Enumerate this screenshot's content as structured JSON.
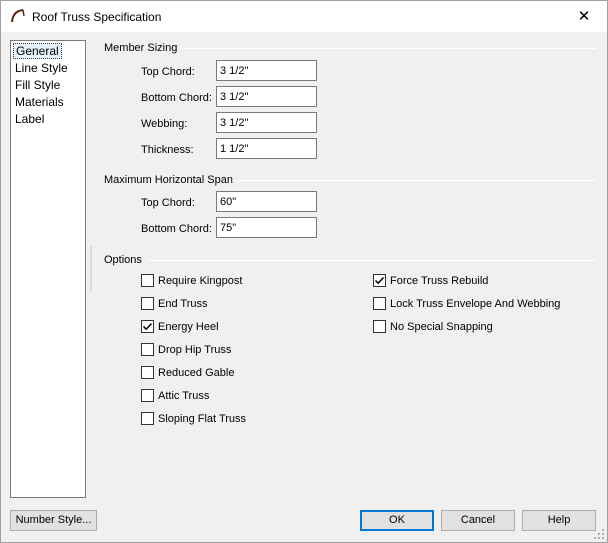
{
  "window": {
    "title": "Roof Truss Specification",
    "close_glyph": "✕"
  },
  "nav": {
    "items": [
      "General",
      "Line Style",
      "Fill Style",
      "Materials",
      "Label"
    ],
    "selected": 0
  },
  "member_sizing": {
    "title": "Member Sizing",
    "fields": [
      {
        "label": "Top Chord:",
        "value": "3 1/2\""
      },
      {
        "label": "Bottom Chord:",
        "value": "3 1/2\""
      },
      {
        "label": "Webbing:",
        "value": "3 1/2\""
      },
      {
        "label": "Thickness:",
        "value": "1 1/2\""
      }
    ]
  },
  "max_span": {
    "title": "Maximum Horizontal Span",
    "fields": [
      {
        "label": "Top Chord:",
        "value": "60\""
      },
      {
        "label": "Bottom Chord:",
        "value": "75\""
      }
    ]
  },
  "options": {
    "title": "Options",
    "left": [
      {
        "label": "Require Kingpost",
        "checked": false
      },
      {
        "label": "End Truss",
        "checked": false
      },
      {
        "label": "Energy Heel",
        "checked": true
      },
      {
        "label": "Drop Hip Truss",
        "checked": false
      },
      {
        "label": "Reduced Gable",
        "checked": false
      },
      {
        "label": "Attic Truss",
        "checked": false
      },
      {
        "label": "Sloping Flat Truss",
        "checked": false
      }
    ],
    "right": [
      {
        "label": "Force Truss Rebuild",
        "checked": true
      },
      {
        "label": "Lock Truss Envelope And Webbing",
        "checked": false
      },
      {
        "label": "No Special Snapping",
        "checked": false
      }
    ]
  },
  "buttons": {
    "number_style": "Number Style...",
    "ok": "OK",
    "cancel": "Cancel",
    "help": "Help"
  },
  "colors": {
    "focus_border": "#0078d7",
    "window_bg": "#f0f0f0"
  },
  "icons": {
    "app": "roof-truss-icon",
    "close": "close-icon",
    "check": "checkmark-icon"
  }
}
